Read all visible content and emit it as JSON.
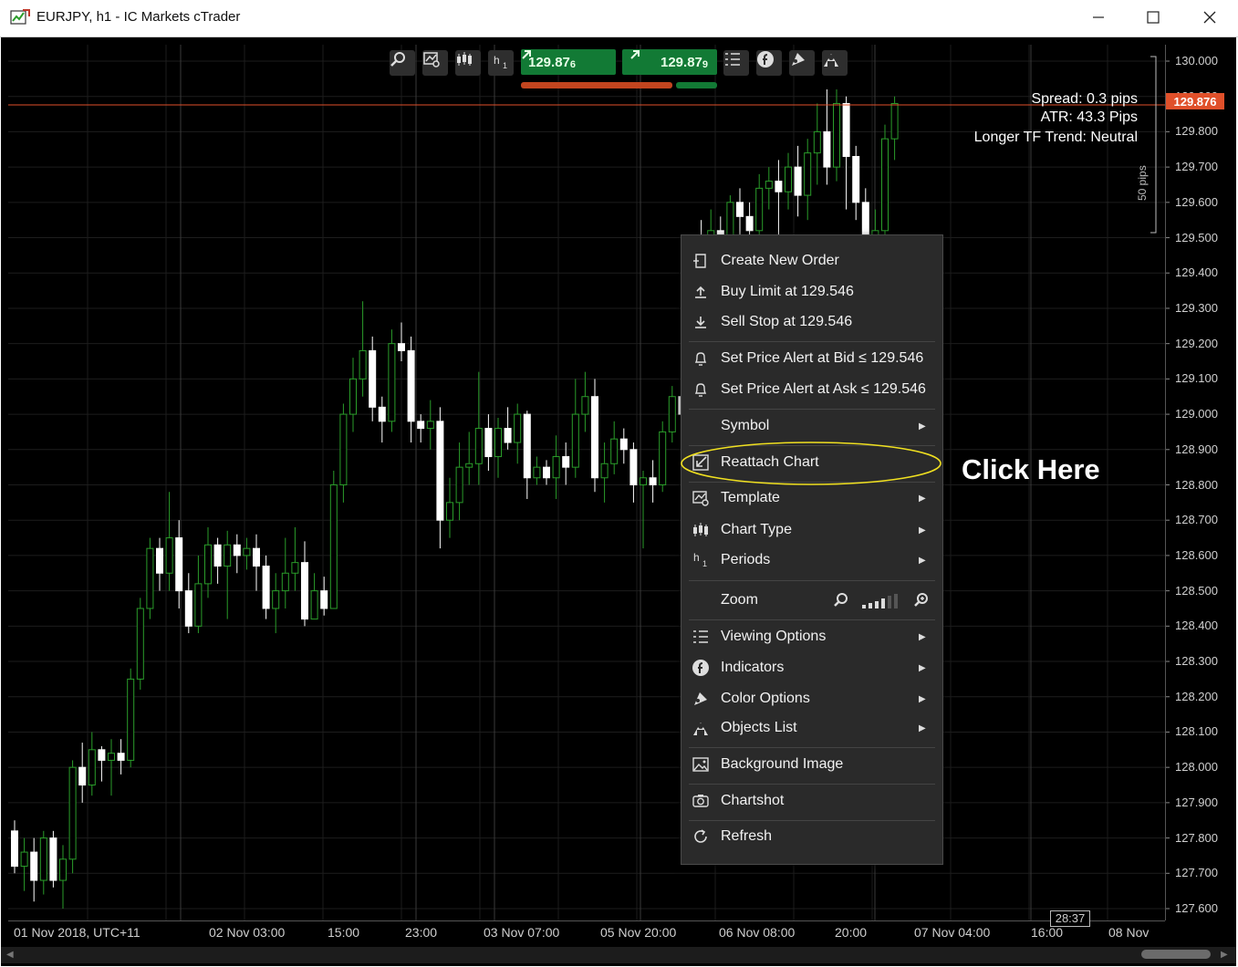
{
  "window": {
    "title": "EURJPY, h1 - IC Markets cTrader",
    "minimize_icon": "minimize-icon",
    "maximize_icon": "maximize-icon",
    "close_icon": "close-icon"
  },
  "toolbar": {
    "periods_label": "h",
    "periods_sub": "1",
    "sell_price_main": "129.87",
    "sell_price_pip": "6",
    "buy_price_main": "129.87",
    "buy_price_pip": "9",
    "icons": [
      "zoom-icon",
      "template-icon",
      "chart-type-icon",
      "periods-icon",
      "viewing-options-icon",
      "indicators-icon",
      "color-options-icon",
      "objects-list-icon"
    ]
  },
  "indicator_overlay": {
    "spread": "Spread: 0.3 pips",
    "atr": "ATR: 43.3 Pips",
    "trend": "Longer TF Trend: Neutral",
    "pips_range": "50 pips"
  },
  "price_axis": {
    "labels": [
      "130.000",
      "129.900",
      "129.800",
      "129.700",
      "129.600",
      "129.500",
      "129.400",
      "129.300",
      "129.200",
      "129.100",
      "129.000",
      "128.900",
      "128.800",
      "128.700",
      "128.600",
      "128.500",
      "128.400",
      "128.300",
      "128.200",
      "128.100",
      "128.000",
      "127.900",
      "127.800",
      "127.700",
      "127.600"
    ],
    "current_price": "129.876"
  },
  "time_axis": {
    "labels": [
      "01 Nov 2018, UTC+11",
      "02 Nov 03:00",
      "15:00",
      "23:00",
      "03 Nov 07:00",
      "05 Nov 20:00",
      "06 Nov 08:00",
      "20:00",
      "07 Nov 04:00",
      "16:00",
      "08 Nov"
    ],
    "countdown": "28:37"
  },
  "context_menu": {
    "items": [
      {
        "label": "Create New Order",
        "icon": "create-order-icon",
        "submenu": false
      },
      {
        "label": "Buy Limit at 129.546",
        "icon": "buy-limit-icon",
        "submenu": false
      },
      {
        "label": "Sell Stop at 129.546",
        "icon": "sell-stop-icon",
        "submenu": false
      },
      {
        "label": "Set Price Alert at Bid ≤ 129.546",
        "icon": "bell-icon",
        "submenu": false
      },
      {
        "label": "Set Price Alert at Ask ≤ 129.546",
        "icon": "bell-icon",
        "submenu": false
      },
      {
        "label": "Symbol",
        "icon": "",
        "submenu": true
      },
      {
        "label": "Reattach Chart",
        "icon": "reattach-icon",
        "submenu": false
      },
      {
        "label": "Template",
        "icon": "template-icon",
        "submenu": true
      },
      {
        "label": "Chart Type",
        "icon": "chart-type-icon",
        "submenu": true
      },
      {
        "label": "Periods",
        "icon": "periods-icon",
        "submenu": true
      },
      {
        "label": "Zoom",
        "icon": "",
        "submenu": false
      },
      {
        "label": "Viewing Options",
        "icon": "viewing-options-icon",
        "submenu": true
      },
      {
        "label": "Indicators",
        "icon": "indicators-icon",
        "submenu": true
      },
      {
        "label": "Color Options",
        "icon": "color-options-icon",
        "submenu": true
      },
      {
        "label": "Objects List",
        "icon": "objects-list-icon",
        "submenu": true
      },
      {
        "label": "Background Image",
        "icon": "background-image-icon",
        "submenu": false
      },
      {
        "label": "Chartshot",
        "icon": "camera-icon",
        "submenu": false
      },
      {
        "label": "Refresh",
        "icon": "refresh-icon",
        "submenu": false
      }
    ],
    "periods_icon_text": "h",
    "periods_icon_sub": "1"
  },
  "annotation": {
    "callout": "Click Here"
  },
  "colors": {
    "chart_background": "#000000",
    "bull_candle": "#2a9d2a",
    "bear_candle": "#ffffff",
    "price_line": "#e0502a",
    "buy_button": "#127a35",
    "highlight_ellipse": "#f0e020"
  },
  "chart_data": {
    "type": "candlestick",
    "symbol": "EURJPY",
    "timeframe": "h1",
    "ylim": [
      127.55,
      130.05
    ],
    "current_price": 129.876,
    "candles": [
      [
        127.82,
        127.72,
        127.85,
        127.7
      ],
      [
        127.72,
        127.76,
        127.8,
        127.65
      ],
      [
        127.76,
        127.68,
        127.8,
        127.62
      ],
      [
        127.68,
        127.8,
        127.82,
        127.64
      ],
      [
        127.8,
        127.68,
        127.82,
        127.66
      ],
      [
        127.68,
        127.74,
        127.78,
        127.6
      ],
      [
        127.74,
        128.0,
        128.02,
        127.7
      ],
      [
        128.0,
        127.95,
        128.07,
        127.9
      ],
      [
        127.95,
        128.05,
        128.1,
        127.92
      ],
      [
        128.05,
        128.02,
        128.06,
        127.96
      ],
      [
        128.02,
        128.04,
        128.08,
        127.92
      ],
      [
        128.04,
        128.02,
        128.08,
        127.98
      ],
      [
        128.02,
        128.25,
        128.28,
        128.0
      ],
      [
        128.25,
        128.45,
        128.48,
        128.22
      ],
      [
        128.45,
        128.62,
        128.65,
        128.42
      ],
      [
        128.62,
        128.55,
        128.65,
        128.5
      ],
      [
        128.55,
        128.65,
        128.78,
        128.5
      ],
      [
        128.65,
        128.5,
        128.7,
        128.45
      ],
      [
        128.5,
        128.4,
        128.55,
        128.38
      ],
      [
        128.4,
        128.52,
        128.6,
        128.38
      ],
      [
        128.52,
        128.63,
        128.68,
        128.48
      ],
      [
        128.63,
        128.57,
        128.65,
        128.52
      ],
      [
        128.57,
        128.63,
        128.67,
        128.42
      ],
      [
        128.63,
        128.6,
        128.66,
        128.55
      ],
      [
        128.6,
        128.62,
        128.65,
        128.56
      ],
      [
        128.62,
        128.57,
        128.66,
        128.5
      ],
      [
        128.57,
        128.45,
        128.6,
        128.42
      ],
      [
        128.45,
        128.5,
        128.55,
        128.38
      ],
      [
        128.5,
        128.55,
        128.65,
        128.45
      ],
      [
        128.55,
        128.58,
        128.68,
        128.5
      ],
      [
        128.58,
        128.42,
        128.64,
        128.4
      ],
      [
        128.42,
        128.5,
        128.55,
        128.42
      ],
      [
        128.5,
        128.45,
        128.54,
        128.43
      ],
      [
        128.45,
        128.8,
        128.84,
        128.45
      ],
      [
        128.8,
        129.0,
        129.03,
        128.75
      ],
      [
        129.0,
        129.1,
        129.16,
        128.95
      ],
      [
        129.1,
        129.18,
        129.32,
        129.05
      ],
      [
        129.18,
        129.02,
        129.22,
        128.98
      ],
      [
        129.02,
        128.98,
        129.05,
        128.92
      ],
      [
        128.98,
        129.2,
        129.24,
        128.95
      ],
      [
        129.2,
        129.18,
        129.26,
        129.15
      ],
      [
        129.18,
        128.98,
        129.22,
        128.92
      ],
      [
        128.98,
        128.96,
        129.0,
        128.92
      ],
      [
        128.96,
        128.98,
        129.04,
        128.9
      ],
      [
        128.98,
        128.7,
        129.02,
        128.62
      ],
      [
        128.7,
        128.75,
        128.82,
        128.65
      ],
      [
        128.75,
        128.85,
        128.92,
        128.7
      ],
      [
        128.85,
        128.86,
        128.95,
        128.8
      ],
      [
        128.86,
        128.96,
        129.12,
        128.8
      ],
      [
        128.96,
        128.88,
        129.0,
        128.84
      ],
      [
        128.88,
        128.96,
        128.99,
        128.82
      ],
      [
        128.96,
        128.92,
        129.02,
        128.9
      ],
      [
        128.92,
        129.0,
        129.03,
        128.86
      ],
      [
        129.0,
        128.82,
        129.01,
        128.76
      ],
      [
        128.82,
        128.85,
        128.88,
        128.8
      ],
      [
        128.85,
        128.82,
        128.87,
        128.8
      ],
      [
        128.82,
        128.88,
        128.94,
        128.76
      ],
      [
        128.88,
        128.85,
        128.92,
        128.8
      ],
      [
        128.85,
        129.0,
        129.1,
        128.82
      ],
      [
        129.0,
        129.05,
        129.12,
        128.95
      ],
      [
        129.05,
        128.82,
        129.1,
        128.78
      ],
      [
        128.82,
        128.86,
        128.92,
        128.75
      ],
      [
        128.86,
        128.93,
        128.98,
        128.83
      ],
      [
        128.93,
        128.9,
        128.96,
        128.86
      ],
      [
        128.9,
        128.8,
        128.92,
        128.75
      ],
      [
        128.8,
        128.82,
        128.84,
        128.62
      ],
      [
        128.82,
        128.8,
        128.87,
        128.75
      ],
      [
        128.8,
        128.95,
        128.98,
        128.78
      ],
      [
        128.95,
        129.05,
        129.08,
        128.92
      ],
      [
        129.05,
        129.0,
        129.08,
        128.96
      ],
      [
        129.0,
        128.98,
        129.04,
        128.95
      ],
      [
        129.5,
        129.45,
        129.55,
        129.4
      ],
      [
        129.45,
        129.52,
        129.58,
        129.42
      ],
      [
        129.52,
        129.48,
        129.56,
        129.44
      ],
      [
        129.48,
        129.6,
        129.62,
        129.45
      ],
      [
        129.6,
        129.56,
        129.64,
        129.5
      ],
      [
        129.56,
        129.52,
        129.6,
        129.45
      ],
      [
        129.52,
        129.64,
        129.68,
        129.48
      ],
      [
        129.64,
        129.66,
        129.7,
        129.58
      ],
      [
        129.66,
        129.63,
        129.72,
        129.42
      ],
      [
        129.63,
        129.7,
        129.74,
        129.58
      ],
      [
        129.7,
        129.62,
        129.76,
        129.56
      ],
      [
        129.62,
        129.74,
        129.78,
        129.55
      ],
      [
        129.74,
        129.8,
        129.88,
        129.65
      ],
      [
        129.8,
        129.7,
        129.92,
        129.65
      ],
      [
        129.7,
        129.88,
        129.92,
        129.66
      ],
      [
        129.88,
        129.73,
        129.9,
        129.58
      ],
      [
        129.73,
        129.6,
        129.76,
        129.55
      ],
      [
        129.6,
        129.48,
        129.64,
        129.4
      ],
      [
        129.48,
        129.52,
        129.58,
        129.42
      ],
      [
        129.52,
        129.78,
        129.82,
        129.5
      ],
      [
        129.78,
        129.88,
        129.9,
        129.72
      ]
    ]
  }
}
